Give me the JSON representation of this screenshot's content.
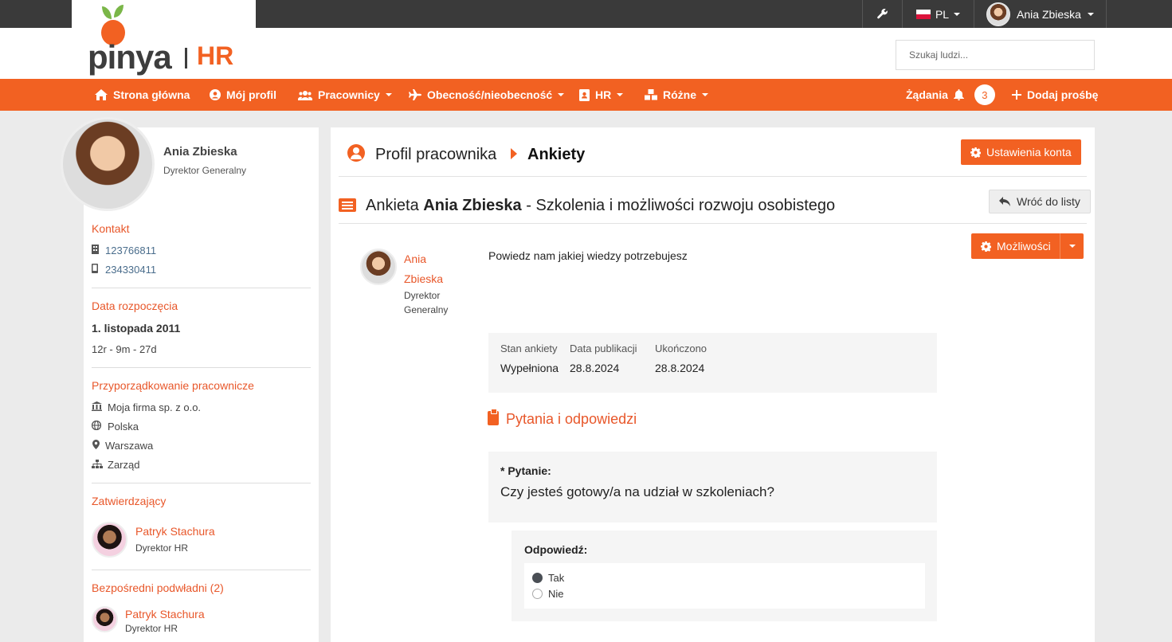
{
  "topbar": {
    "language": "PL",
    "user_name": "Ania Zbieska"
  },
  "brand": {
    "logo_text": "pinya",
    "logo_suffix": "HR"
  },
  "search": {
    "placeholder": "Szukaj ludzi..."
  },
  "nav": {
    "items": [
      {
        "label": "Strona główna",
        "icon": "home-icon"
      },
      {
        "label": "Mój profil",
        "icon": "user-circle-icon"
      },
      {
        "label": "Pracownicy",
        "icon": "users-icon"
      },
      {
        "label": "Obecność/nieobecność",
        "icon": "plane-icon"
      },
      {
        "label": "HR",
        "icon": "id-card-icon"
      },
      {
        "label": "Różne",
        "icon": "cubes-icon"
      }
    ],
    "requests_label": "Żądania",
    "requests_count": "3",
    "add_request_label": "Dodaj prośbę"
  },
  "sidebar": {
    "name": "Ania Zbieska",
    "role": "Dyrektor Generalny",
    "contact_title": "Kontakt",
    "phone1": "123766811",
    "phone2": "234330411",
    "start_title": "Data rozpoczęcia",
    "start_date": "1. listopada 2011",
    "tenure": "12r - 9m - 27d",
    "assignment_title": "Przyporządkowanie pracownicze",
    "company": "Moja firma sp. z o.o.",
    "country": "Polska",
    "city": "Warszawa",
    "department": "Zarząd",
    "approvers_title": "Zatwierdzający",
    "approver_name": "Patryk Stachura",
    "approver_role": "Dyrektor HR",
    "subordinates_title": "Bezpośredni podwładni (2)",
    "subordinate_name": "Patryk Stachura",
    "subordinate_role": "Dyrektor HR"
  },
  "main": {
    "breadcrumb_parent": "Profil pracownika",
    "breadcrumb_current": "Ankiety",
    "account_settings_label": "Ustawienia konta",
    "title_prefix": "Ankieta",
    "title_person": "Ania Zbieska",
    "title_suffix": "- Szkolenia i możliwości rozwoju osobistego",
    "back_label": "Wróć do listy",
    "options_label": "Możliwości",
    "author_name": "Ania Zbieska",
    "author_role": "Dyrektor Generalny",
    "description": "Powiedz nam jakiej wiedzy potrzebujesz",
    "info": {
      "status_label": "Stan ankiety",
      "status_value": "Wypełniona",
      "published_label": "Data publikacji",
      "published_value": "28.8.2024",
      "completed_label": "Ukończono",
      "completed_value": "28.8.2024"
    },
    "qa_title": "Pytania i odpowiedzi",
    "question_label": "* Pytanie:",
    "question_text": "Czy jesteś gotowy/a na udział w szkoleniach?",
    "answer_label": "Odpowiedź:",
    "answer_options": [
      {
        "label": "Tak",
        "selected": true
      },
      {
        "label": "Nie",
        "selected": false
      }
    ]
  },
  "colors": {
    "accent": "#f26122",
    "topbar": "#3a3a3a",
    "background": "#ebebeb"
  }
}
